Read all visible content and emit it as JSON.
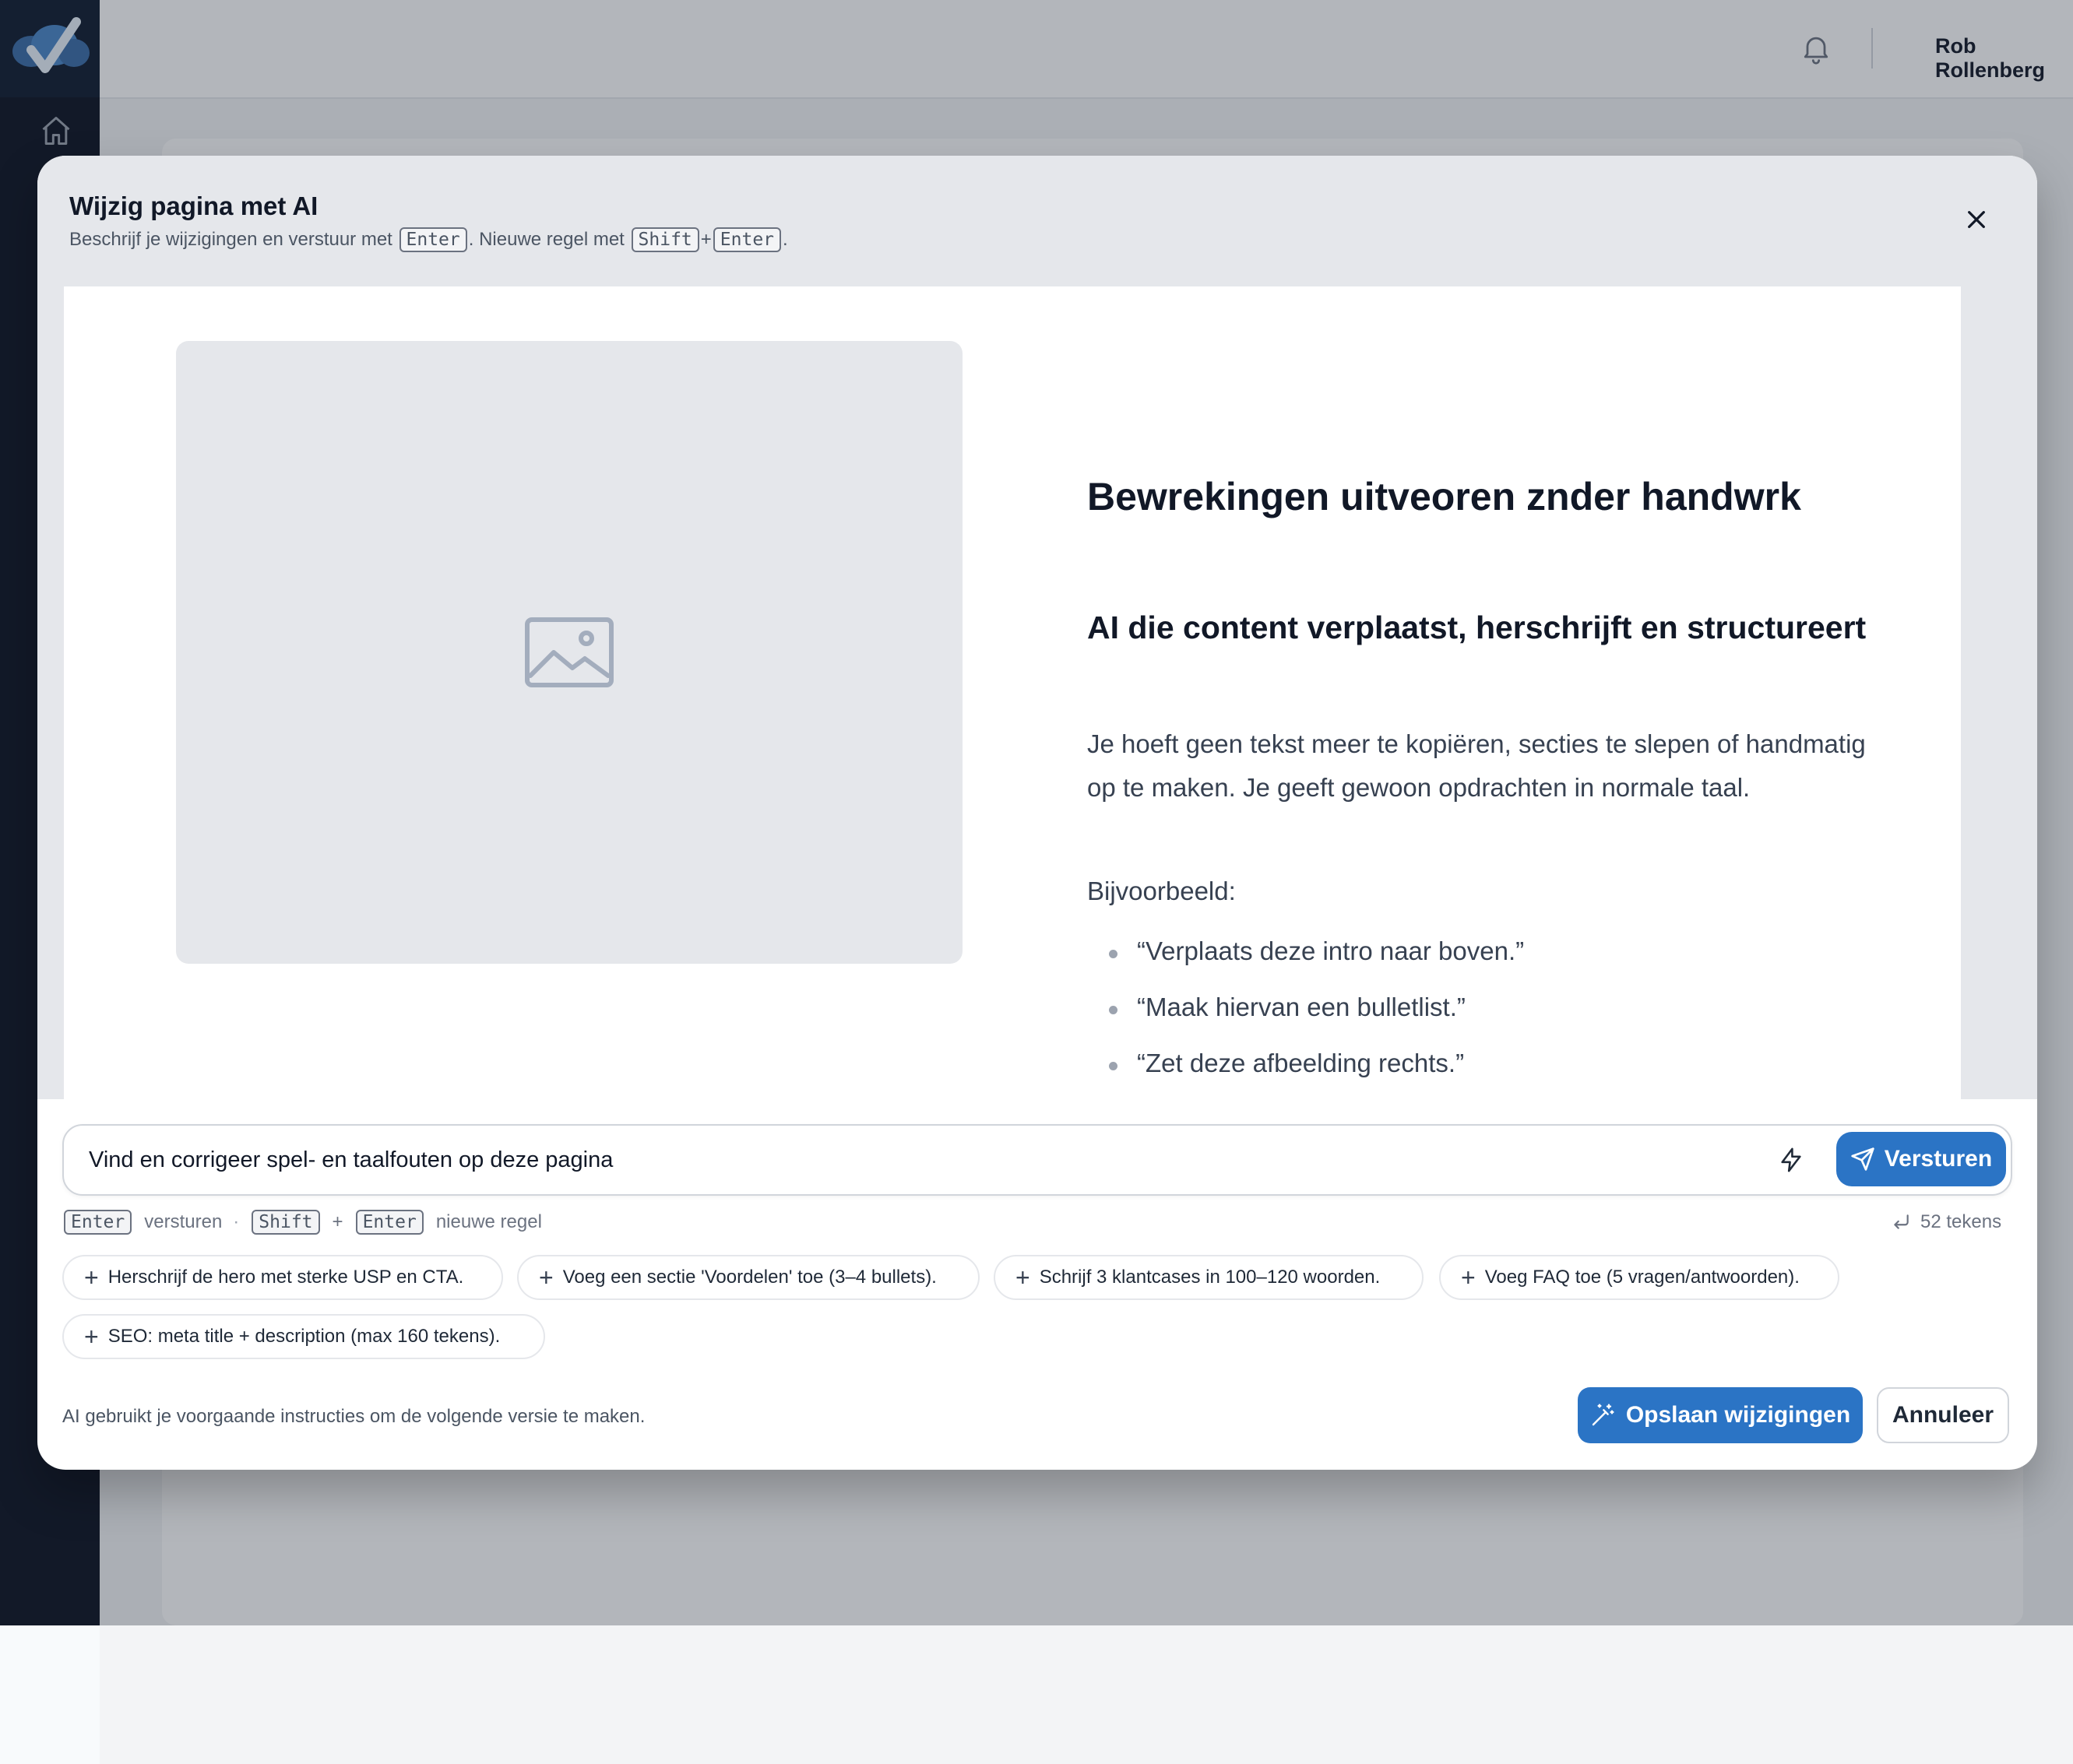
{
  "app": {
    "user_name": "Rob Rollenberg"
  },
  "modal": {
    "title": "Wijzig pagina met AI",
    "subtitle_part1": "Beschrijf je wijzigingen en verstuur met",
    "subtitle_key_enter": "Enter",
    "subtitle_part2": ". Nieuwe regel met",
    "subtitle_key_shift": "Shift",
    "subtitle_plus": "+",
    "subtitle_key_enter2": "Enter",
    "subtitle_end": "."
  },
  "preview": {
    "heading": "Bewrekingen uitveoren znder handwrk",
    "subheading": "AI die content verplaatst, herschrijft en structureert",
    "paragraph": "Je hoeft geen tekst meer te kopiëren, secties te slepen of handmatig op te maken. Je geeft gewoon opdrachten in normale taal.",
    "example_label": "Bijvoorbeeld:",
    "examples": [
      "“Verplaats deze intro naar boven.”",
      "“Maak hiervan een bulletlist.”",
      "“Zet deze afbeelding rechts.”"
    ]
  },
  "prompt": {
    "value": "Vind en corrigeer spel- en taalfouten op deze pagina",
    "send_label": "Versturen"
  },
  "hints": {
    "key_enter": "Enter",
    "send_text": "versturen",
    "separator": "·",
    "key_shift": "Shift",
    "plus": "+",
    "key_enter2": "Enter",
    "newline_text": "nieuwe regel",
    "char_count": "52 tekens"
  },
  "suggestions": [
    "Herschrijf de hero met sterke USP en CTA.",
    "Voeg een sectie 'Voordelen' toe (3–4 bullets).",
    "Schrijf 3 klantcases in 100–120 woorden.",
    "Voeg FAQ toe (5 vragen/antwoorden).",
    "SEO: meta title + description (max 160 tekens)."
  ],
  "footer": {
    "note": "AI gebruikt je voorgaande instructies om de volgende versie te maken.",
    "save_label": "Opslaan wijzigingen",
    "cancel_label": "Annuleer"
  },
  "colors": {
    "primary": "#2b74c5",
    "sidebar": "#0b1120"
  }
}
